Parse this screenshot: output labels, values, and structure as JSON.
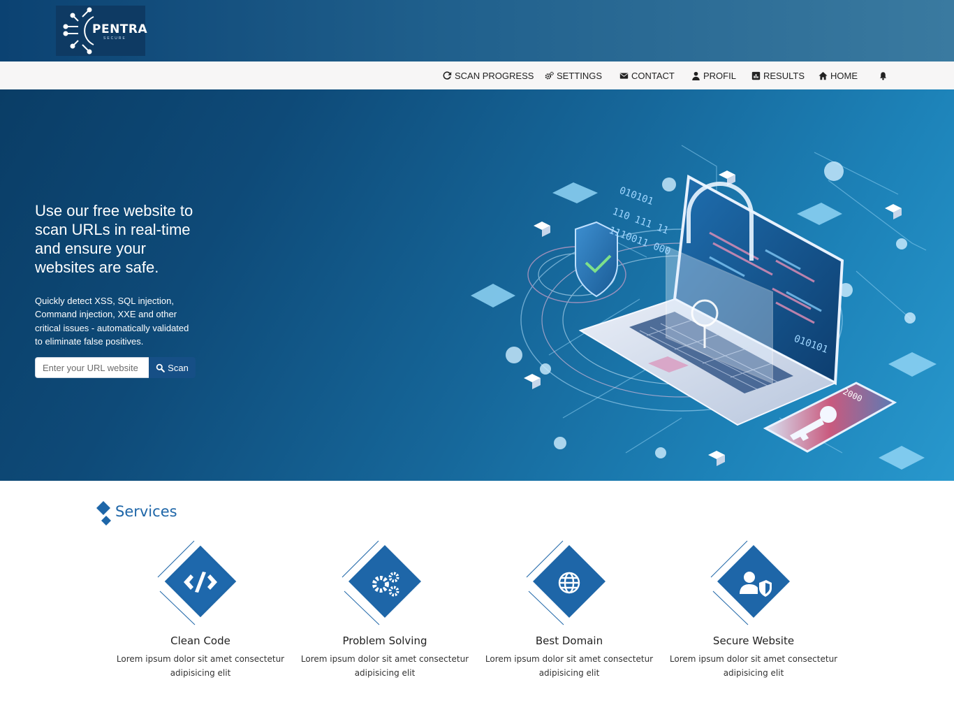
{
  "brand": {
    "name": "PENTRA",
    "tagline": "SECURE"
  },
  "nav": {
    "items": [
      {
        "label": "SCAN PROGRESS",
        "icon": "refresh-icon"
      },
      {
        "label": "SETTINGS",
        "icon": "gears-icon"
      },
      {
        "label": "CONTACT",
        "icon": "envelope-icon"
      },
      {
        "label": "PROFIL",
        "icon": "user-icon"
      },
      {
        "label": "RESULTS",
        "icon": "bar-chart-icon"
      },
      {
        "label": "HOME",
        "icon": "home-icon"
      }
    ],
    "bell_icon": "bell-icon"
  },
  "hero": {
    "title": "Use our free website to scan URLs in real-time and ensure your websites are safe.",
    "description": "Quickly detect XSS, SQL injection, Command injection, XXE and other critical issues - automatically validated to eliminate false positives.",
    "search_placeholder": "Enter your URL website",
    "search_value": "",
    "scan_label": "Scan",
    "binary_text_1": "010101",
    "binary_text_2": "2000"
  },
  "services": {
    "heading": "Services",
    "cards": [
      {
        "title": "Clean Code",
        "text": "Lorem ipsum dolor sit amet consectetur adipisicing elit",
        "icon": "code-icon"
      },
      {
        "title": "Problem Solving",
        "text": "Lorem ipsum dolor sit amet consectetur adipisicing elit",
        "icon": "gears-icon"
      },
      {
        "title": "Best Domain",
        "text": "Lorem ipsum dolor sit amet consectetur adipisicing elit",
        "icon": "globe-icon"
      },
      {
        "title": "Secure Website",
        "text": "Lorem ipsum dolor sit amet consectetur adipisicing elit",
        "icon": "user-shield-icon"
      }
    ]
  },
  "colors": {
    "accent": "#1e66a8",
    "header": "#0b4272",
    "hero_end": "#2898cd"
  }
}
